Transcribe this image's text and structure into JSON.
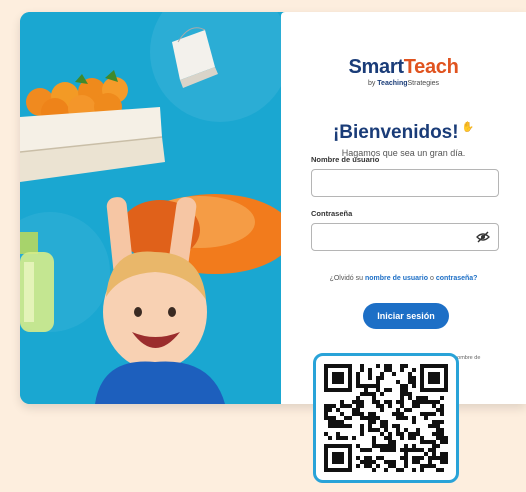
{
  "brand": {
    "name_part1": "Smart",
    "name_part2": "Teach",
    "by": "by",
    "company_bold": "Teaching",
    "company_rest": "Strategies"
  },
  "welcome": {
    "title": "¡Bienvenidos!",
    "tagline": "Hagamos que sea un gran día."
  },
  "form": {
    "username_label": "Nombre de usuario",
    "username_value": "",
    "password_label": "Contraseña",
    "password_value": ""
  },
  "forgot": {
    "prefix": "¿Olvidó su",
    "username_link": "nombre de usuario",
    "conj": "o",
    "password_link": "contraseña?"
  },
  "submit_label": "Iniciar sesión",
  "contact_text": "Por favor contacte a su Administrador si no tiene un nombre de",
  "icons": {
    "eye": "eye-slash-icon",
    "wave": "waving-hand-icon"
  },
  "colors": {
    "accent": "#1d6fc6",
    "brand_navy": "#1a3c78",
    "background": "#fdeede",
    "photo_blue": "#1aa7d1"
  }
}
